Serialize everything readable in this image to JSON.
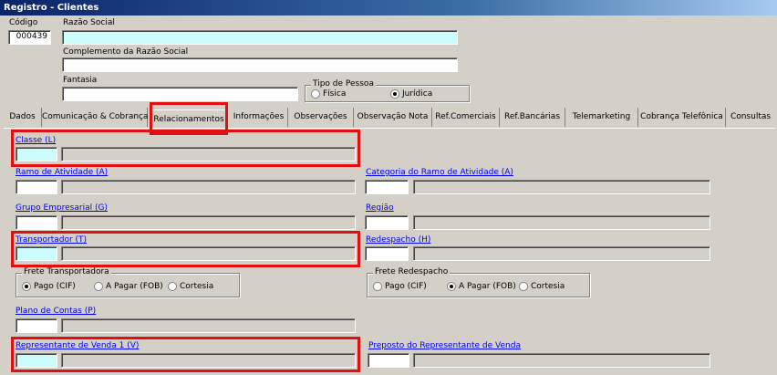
{
  "window": {
    "title": "Registro - Clientes"
  },
  "header": {
    "codigo_label": "Código",
    "codigo_value": "000439",
    "razao_social_label": "Razão Social",
    "razao_social_value": "",
    "complemento_label": "Complemento da Razão Social",
    "complemento_value": "",
    "fantasia_label": "Fantasia",
    "fantasia_value": "",
    "tipo_pessoa": {
      "title": "Tipo de Pessoa",
      "options": [
        "Física",
        "Jurídica"
      ],
      "selected": "Jurídica"
    }
  },
  "tabs": [
    "Dados",
    "Comunicação & Cobrança",
    "Relacionamentos",
    "Informações",
    "Observações",
    "Observação Nota",
    "Ref.Comerciais",
    "Ref.Bancárias",
    "Telemarketing",
    "Cobrança Telefônica",
    "Consultas"
  ],
  "active_tab": "Relacionamentos",
  "relacionamentos": {
    "classe": "Classe (L)",
    "ramo_atividade": "Ramo de Atividade (A)",
    "categoria_ramo": "Categoria do Ramo de Atividade (A)",
    "grupo_empresarial": "Grupo Empresarial (G)",
    "regiao": "Região",
    "transportador": "Transportador (T)",
    "redespacho": "Redespacho (H)",
    "frete_transportadora": {
      "title": "Frete Transportadora",
      "options": [
        "Pago (CIF)",
        "A Pagar (FOB)",
        "Cortesia"
      ],
      "selected": "Pago (CIF)"
    },
    "frete_redespacho": {
      "title": "Frete Redespacho",
      "options": [
        "Pago (CIF)",
        "A Pagar (FOB)",
        "Cortesia"
      ],
      "selected": "A Pagar (FOB)"
    },
    "plano_contas": "Plano de Contas (P)",
    "representante_venda": "Representante de Venda 1 (V)",
    "preposto_representante": "Preposto do Representante de Venda"
  },
  "colors": {
    "highlight": "#e01010",
    "link": "#0000ee",
    "field_highlight": "#ccfcfc",
    "window_bg": "#d4d0c8"
  }
}
